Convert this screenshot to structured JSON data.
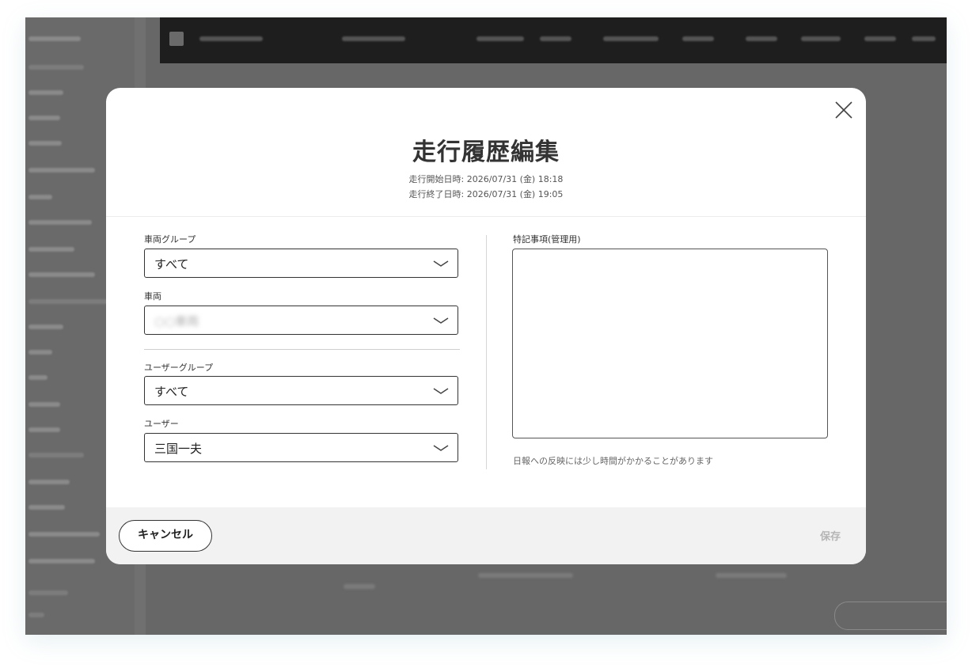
{
  "modal": {
    "title": "走行履歴編集",
    "start_line": "走行開始日時: 2026/07/31 (金) 18:18",
    "end_line": "走行終了日時: 2026/07/31 (金) 19:05"
  },
  "fields": {
    "vehicle_group": {
      "label": "車両グループ",
      "value": "すべて"
    },
    "vehicle": {
      "label": "車両",
      "value": "○○車両"
    },
    "user_group": {
      "label": "ユーザーグループ",
      "value": "すべて"
    },
    "user": {
      "label": "ユーザー",
      "value": "三国一夫"
    },
    "remarks": {
      "label": "特記事項(管理用)",
      "value": ""
    }
  },
  "note": "日報への反映には少し時間がかかることがあります",
  "footer": {
    "cancel_label": "キャンセル",
    "save_label": "保存"
  },
  "icons": {
    "close": "close-icon",
    "chevron": "chevron-down-icon"
  },
  "colors": {
    "overlay": "#5c5c5c",
    "footer_bg": "#f2f2f2",
    "save_disabled": "#b5b5b5"
  }
}
